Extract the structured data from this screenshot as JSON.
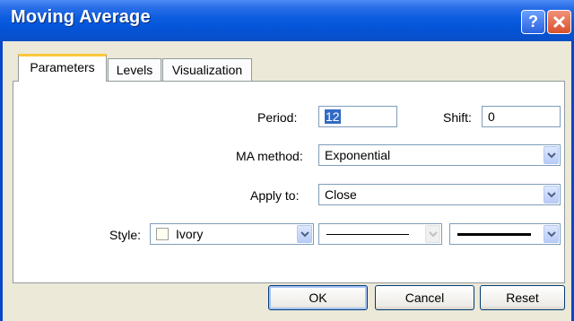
{
  "window": {
    "title": "Moving Average",
    "help_label": "?",
    "close_label": "×"
  },
  "tabs": [
    {
      "label": "Parameters",
      "active": true
    },
    {
      "label": "Levels",
      "active": false
    },
    {
      "label": "Visualization",
      "active": false
    }
  ],
  "params": {
    "period_label": "Period:",
    "period_value": "12",
    "shift_label": "Shift:",
    "shift_value": "0",
    "ma_method_label": "MA method:",
    "ma_method_value": "Exponential",
    "apply_to_label": "Apply to:",
    "apply_to_value": "Close",
    "style_label": "Style:",
    "color_value": "Ivory",
    "color_hex": "#fffff0"
  },
  "buttons": {
    "ok": "OK",
    "cancel": "Cancel",
    "reset": "Reset"
  }
}
